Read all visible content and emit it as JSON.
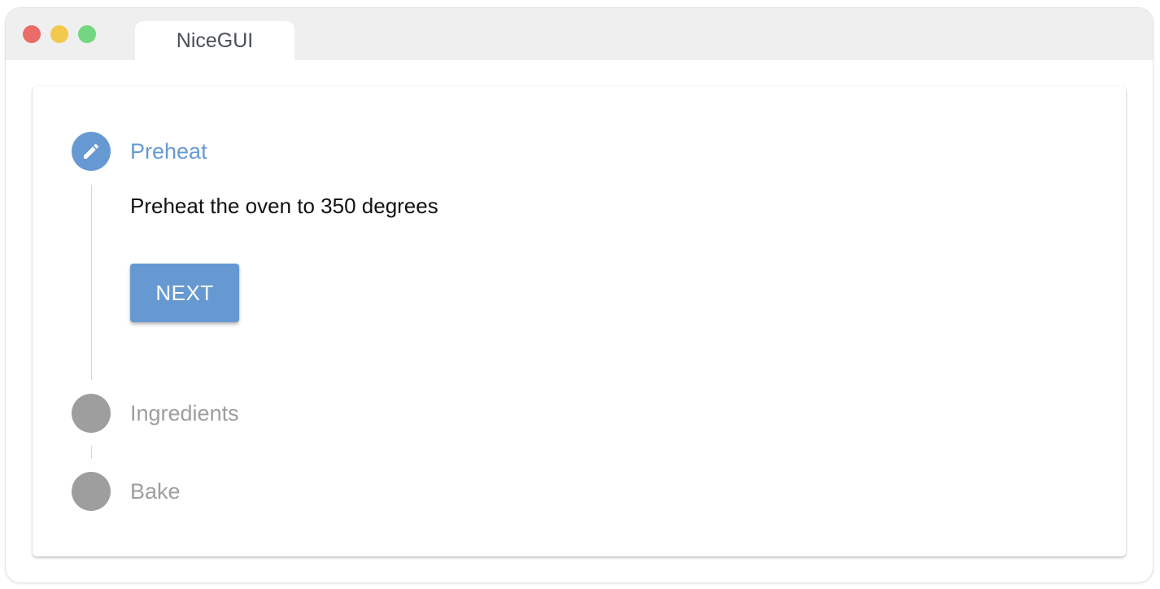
{
  "window": {
    "tab_title": "NiceGUI"
  },
  "stepper": {
    "steps": [
      {
        "title": "Preheat",
        "state": "active",
        "icon": "pencil-icon",
        "content": "Preheat the oven to 350 degrees",
        "next_label": "NEXT"
      },
      {
        "title": "Ingredients",
        "state": "inactive"
      },
      {
        "title": "Bake",
        "state": "inactive"
      }
    ]
  },
  "colors": {
    "accent": "#6699d2",
    "inactive": "#9e9e9e",
    "titlebar": "#efefef",
    "close": "#ea6b68",
    "minimize": "#f2c94c",
    "maximize": "#74d681"
  }
}
